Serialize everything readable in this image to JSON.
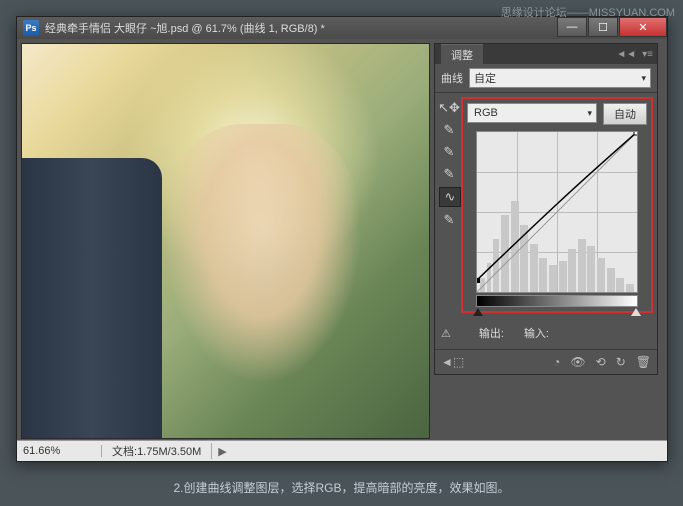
{
  "watermark": "思缘设计论坛——MISSYUAN.COM",
  "titlebar": {
    "icon_text": "Ps",
    "title": "经典牵手情侣   大眼仔 ~旭.psd @ 61.7% (曲线 1, RGB/8) *"
  },
  "win_controls": {
    "min": "—",
    "max": "☐",
    "close": "✕"
  },
  "adjustments_panel": {
    "tab_label": "调整",
    "preset_label": "曲线",
    "preset_value": "自定",
    "channel_value": "RGB",
    "auto_button": "自动",
    "output_label": "输出:",
    "input_label": "输入:"
  },
  "statusbar": {
    "zoom": "61.66%",
    "doc_label": "文档:",
    "doc_size": "1.75M/3.50M"
  },
  "caption": "2.创建曲线调整图层，选择RGB，提高暗部的亮度，效果如图。"
}
